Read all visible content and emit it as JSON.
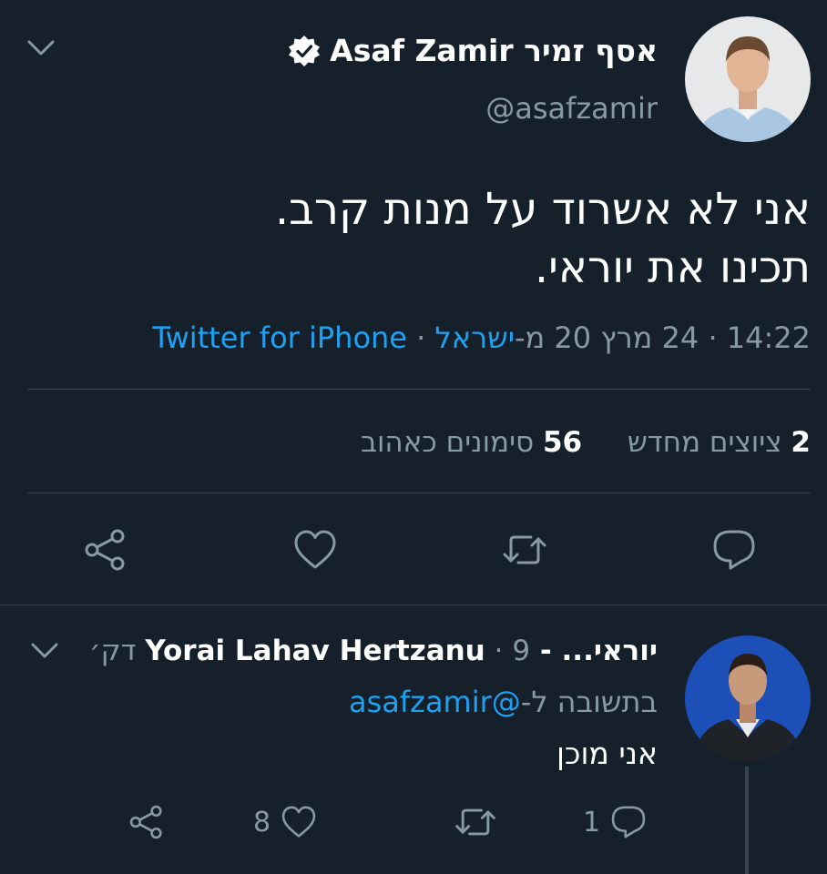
{
  "tweet": {
    "author_name": "Asaf Zamir אסף זמיר",
    "handle": "@asafzamir",
    "text_lines": [
      "אני לא אשרוד על מנות קרב.",
      "תכינו את יוראי."
    ],
    "time": "14:22",
    "date": "24 מרץ 20",
    "location_prefix": "מ-",
    "location": "ישראל",
    "source": "Twitter for iPhone",
    "retweets_count": "2",
    "retweets_label": "ציוצים מחדש",
    "likes_count": "56",
    "likes_label": "סימונים כאהוב"
  },
  "reply": {
    "name": "יוראי... - Yorai Lahav Hertzanu",
    "age": "9 דק׳",
    "reply_prefix": "בתשובה ל-",
    "reply_to": "@asafzamir",
    "text": "אני מוכן",
    "reply_count": "1",
    "like_count": "8"
  },
  "colors": {
    "background": "#15202b",
    "muted": "#8899a6",
    "link": "#1da1f2",
    "divider": "#38444d"
  },
  "icons": [
    "chevron-down-icon",
    "verified-badge-icon",
    "reply-icon",
    "retweet-icon",
    "like-icon",
    "share-icon"
  ]
}
